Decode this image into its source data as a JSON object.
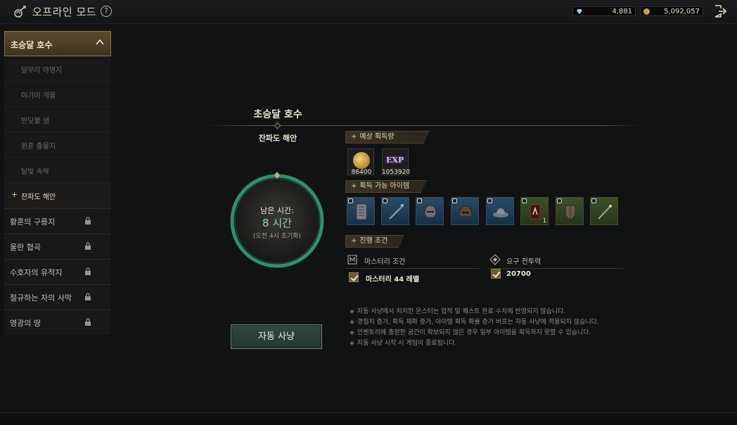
{
  "header": {
    "title": "오프라인 모드",
    "help_icon": "?",
    "currencies": [
      {
        "icon": "diamond-icon",
        "value": "4,881"
      },
      {
        "icon": "gold-coin-icon",
        "value": "5,092,057"
      }
    ]
  },
  "sidebar": {
    "expanded": {
      "label": "초승달 호수",
      "subitems": [
        {
          "label": "달무리 야영지"
        },
        {
          "label": "아가미 개울"
        },
        {
          "label": "반딧불 샘"
        },
        {
          "label": "원혼 출몰지"
        },
        {
          "label": "달빛 속박"
        },
        {
          "label": "잔파도 해안",
          "marker": "+"
        }
      ]
    },
    "regions": [
      {
        "label": "황혼의 구릉지"
      },
      {
        "label": "울란 협곡"
      },
      {
        "label": "수호자의 유적지"
      },
      {
        "label": "절규하는 자의 사막"
      },
      {
        "label": "영광의 땅"
      }
    ]
  },
  "main": {
    "location_title": "초승달 호수",
    "sub_location": "잔파도 해안",
    "timer": {
      "label": "남은 시간:",
      "value": "8 시간",
      "note": "(오전 4시 초기화)"
    },
    "auto_hunt_button": "자동 사냥",
    "expected_section": "예상 획득량",
    "expected_rewards": [
      {
        "icon": "gold-coin-icon",
        "value": "86400"
      },
      {
        "icon": "exp-icon",
        "label": "EXP",
        "value": "1053920"
      }
    ],
    "items_section": "획득 가능 아이템",
    "items": [
      {
        "icon": "armor-plate-icon",
        "grade": "blue"
      },
      {
        "icon": "spear-icon",
        "grade": "blue"
      },
      {
        "icon": "helmet-icon",
        "grade": "blue"
      },
      {
        "icon": "hood-helmet-icon",
        "grade": "blue"
      },
      {
        "icon": "hat-icon",
        "grade": "blue"
      },
      {
        "icon": "scroll-book-icon",
        "grade": "green",
        "count": "1"
      },
      {
        "icon": "shield-icon",
        "grade": "green"
      },
      {
        "icon": "staff-icon",
        "grade": "green"
      }
    ],
    "progress_section": "진행 조건",
    "mastery_condition": {
      "label": "마스터리 조건",
      "value": "마스터리 44 레벨"
    },
    "power_condition": {
      "label": "요구 전투력",
      "value": "20700"
    },
    "notes": [
      "자동 사냥에서 처치한 몬스터는 업적 및 퀘스트 완료 수치에 반영되지 않습니다.",
      "경험치 증가, 획득 재화 증가, 아이템 획득 확률 증가 버프는 자동 사냥에 적용되지 않습니다.",
      "인벤토리에 충분한 공간이 확보되지 않은 경우 일부 아이템을 획득하지 못할 수 있습니다.",
      "자동 사냥 시작 시 게임이 종료됩니다."
    ],
    "note_bullet": "◈"
  },
  "colors": {
    "accent_gold": "#8b7443",
    "timer_green": "#2f8f6e",
    "button_green": "#33473f"
  }
}
